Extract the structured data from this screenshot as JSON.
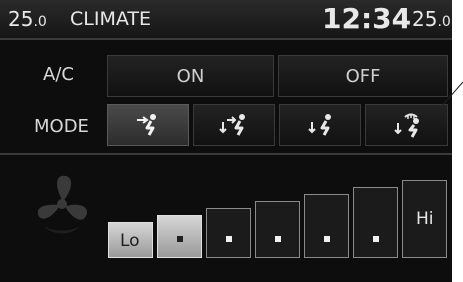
{
  "header": {
    "left_temp_int": "25",
    "left_temp_dec": ".0",
    "title": "CLIMATE",
    "time": "12:34",
    "right_temp_int": "25",
    "right_temp_dec": ".0"
  },
  "ac": {
    "label": "A/C",
    "on_label": "ON",
    "off_label": "OFF",
    "state": "ON"
  },
  "mode": {
    "label": "MODE",
    "options": [
      {
        "icon": "vent-mode-icon",
        "active": true
      },
      {
        "icon": "bilevel-mode-icon",
        "active": false
      },
      {
        "icon": "floor-mode-icon",
        "active": false
      },
      {
        "icon": "floor-defrost-mode-icon",
        "active": false
      }
    ]
  },
  "fan": {
    "icon": "fan-icon",
    "low_label": "Lo",
    "high_label": "Hi",
    "total_levels": 7,
    "current_level": 2
  },
  "colors": {
    "background": "#0d0d0d",
    "text": "#e6e6e6",
    "active_bar": "#c8c8c8"
  }
}
